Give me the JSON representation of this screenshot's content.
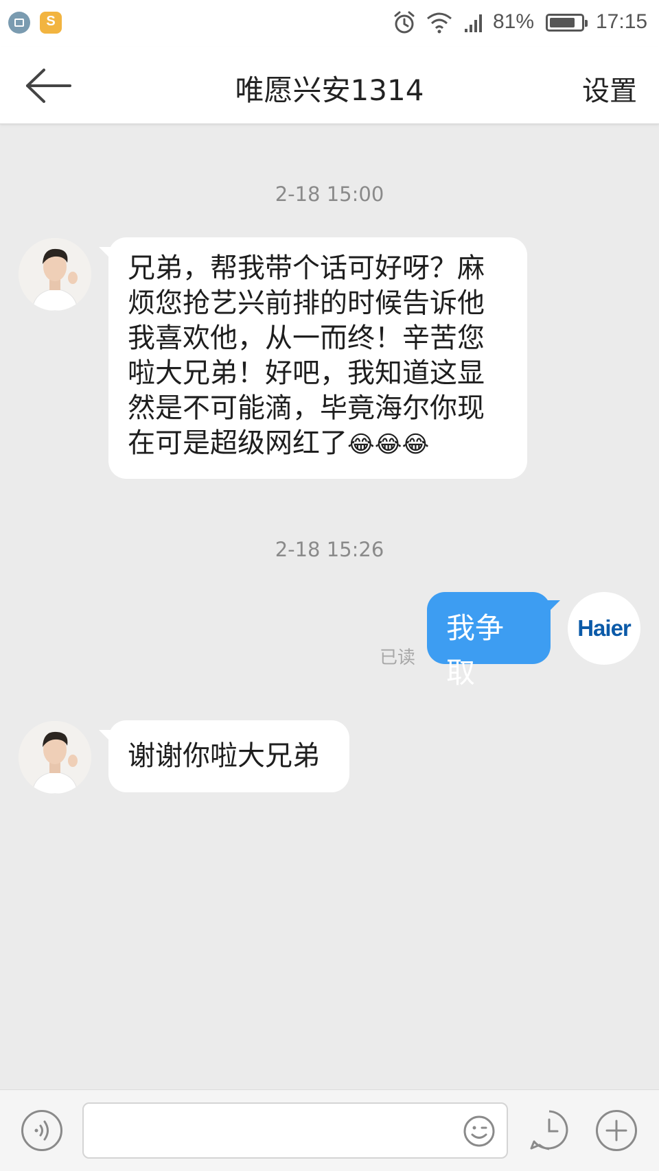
{
  "status_bar": {
    "battery_percent": "81%",
    "battery_level": 0.81,
    "time": "17:15"
  },
  "header": {
    "title": "唯愿兴安1314",
    "settings_label": "设置"
  },
  "messages": [
    {
      "timestamp": "2-18 15:00"
    },
    {
      "side": "left",
      "lines": [
        "兄弟，帮我带个话可好呀？麻",
        "烦您抢艺兴前排的时候告诉他",
        "我喜欢他，从一而终！辛苦您",
        "啦大兄弟！好吧，我知道这显",
        "然是不可能滴，毕竟海尔你现",
        "在可是超级网红了"
      ],
      "emoji": "😂😂😂"
    },
    {
      "timestamp": "2-18 15:26"
    },
    {
      "side": "right",
      "text": "我争取",
      "read_status": "已读",
      "avatar_logo": "Haier"
    },
    {
      "side": "left",
      "text": "谢谢你啦大兄弟"
    }
  ],
  "input_bar": {
    "placeholder": "",
    "value": ""
  },
  "colors": {
    "background": "#ebebeb",
    "bubble_out": "#3d9df2",
    "bubble_in": "#ffffff",
    "haier_blue": "#0b5aa8"
  },
  "icons": [
    "back-arrow-icon",
    "alarm-icon",
    "wifi-icon",
    "signal-icon",
    "battery-icon",
    "voice-icon",
    "emoji-icon",
    "clock-icon",
    "plus-icon"
  ]
}
